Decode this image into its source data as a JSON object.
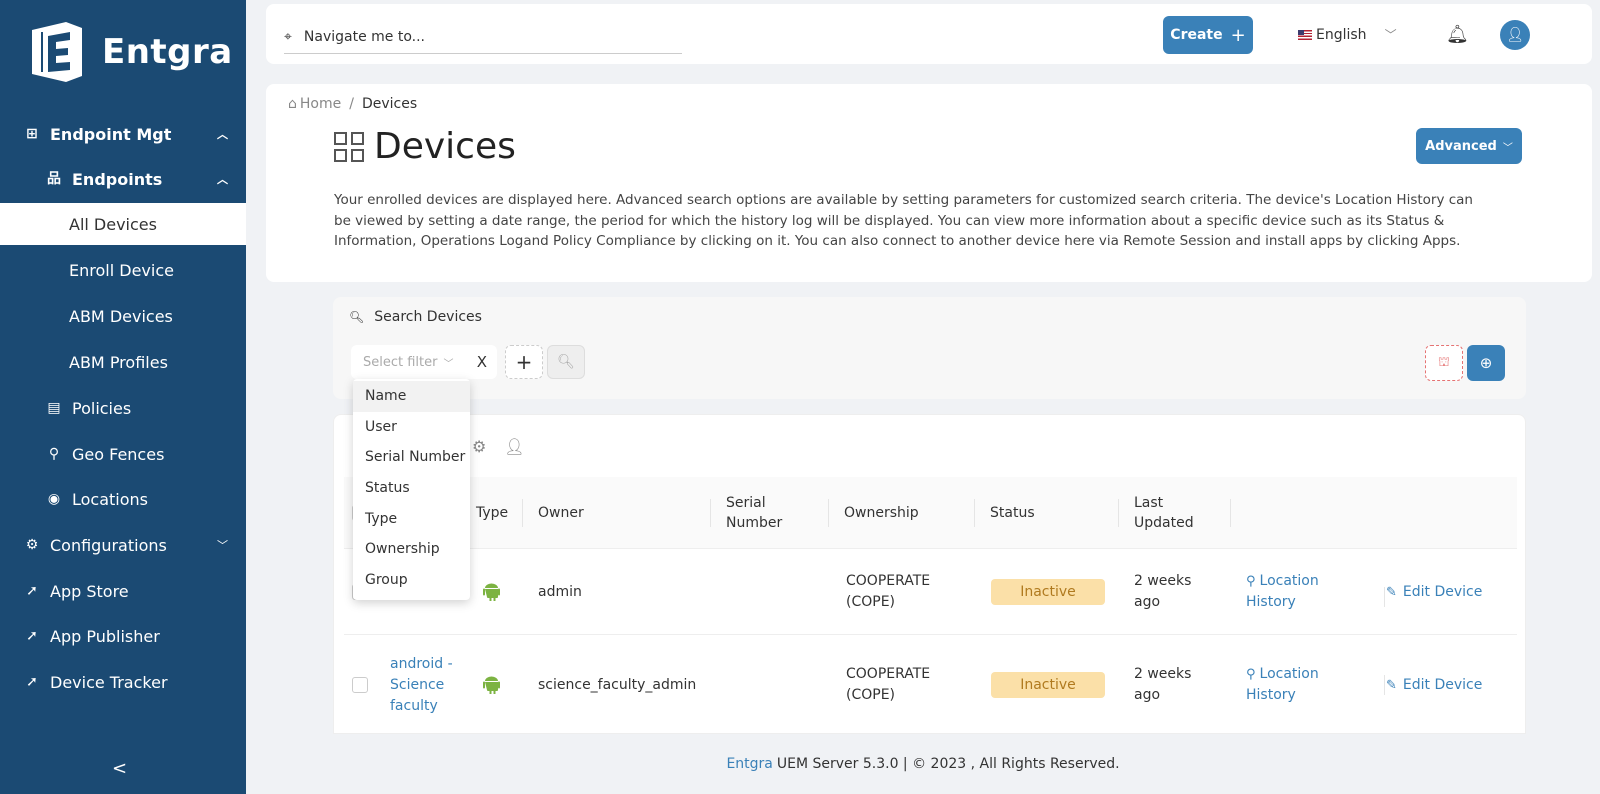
{
  "brand": {
    "logo_text": "Entgra"
  },
  "sidebar": {
    "items": [
      {
        "label": "Endpoint Mgt",
        "icon": "apps-grid-icon"
      },
      {
        "label": "Endpoints",
        "icon": "hierarchy-icon"
      },
      {
        "label": "All Devices"
      },
      {
        "label": "Enroll Device"
      },
      {
        "label": "ABM Devices"
      },
      {
        "label": "ABM Profiles"
      },
      {
        "label": "Policies",
        "icon": "document-check-icon"
      },
      {
        "label": "Geo Fences",
        "icon": "geofence-icon"
      },
      {
        "label": "Locations",
        "icon": "map-pin-icon"
      },
      {
        "label": "Configurations",
        "icon": "gear-icon"
      },
      {
        "label": "App Store",
        "icon": "rocket-icon"
      },
      {
        "label": "App Publisher",
        "icon": "rocket-icon"
      },
      {
        "label": "Device Tracker",
        "icon": "rocket-icon"
      }
    ],
    "collapse_glyph": "<"
  },
  "topbar": {
    "nav_placeholder": "Navigate me to...",
    "create_label": "Create",
    "language": "English"
  },
  "breadcrumb": {
    "home": "Home",
    "current": "Devices"
  },
  "page": {
    "title": "Devices",
    "advanced_label": "Advanced",
    "description": "Your enrolled devices are displayed here. Advanced search options are available by setting parameters for customized search criteria. The device's Location History can be viewed by setting a date range, the period for which the history log will be displayed. You can view more information about a specific device such as its Status & Information, Operations Logand Policy Compliance by clicking on it. You can also connect to another device here via Remote Session and install apps by clicking Apps."
  },
  "search": {
    "label": "Search Devices",
    "filter_placeholder": "Select filter",
    "clear_glyph": "X"
  },
  "filter_options": [
    "Name",
    "User",
    "Serial Number",
    "Status",
    "Type",
    "Ownership",
    "Group"
  ],
  "table": {
    "headers": {
      "type": "Type",
      "owner": "Owner",
      "serial": "Serial Number",
      "ownership": "Ownership",
      "status": "Status",
      "last_updated": "Last Updated"
    },
    "rows": [
      {
        "name": "",
        "owner": "admin",
        "ownership": "COOPERATE (COPE)",
        "status": "Inactive",
        "last_updated": "2 weeks ago",
        "location_link": "Location History",
        "edit_link": "Edit Device"
      },
      {
        "name": "android - Science faculty",
        "owner": "science_faculty_admin",
        "ownership": "COOPERATE (COPE)",
        "status": "Inactive",
        "last_updated": "2 weeks ago",
        "location_link": "Location History",
        "edit_link": "Edit Device"
      }
    ]
  },
  "footer": {
    "brand": "Entgra",
    "text": "UEM Server 5.3.0 | © 2023 , All Rights Reserved."
  },
  "colors": {
    "sidebar_bg": "#1b4a73",
    "accent": "#3a81b8",
    "status_inactive_bg": "#fbe0a8",
    "android_green": "#7cb342"
  }
}
